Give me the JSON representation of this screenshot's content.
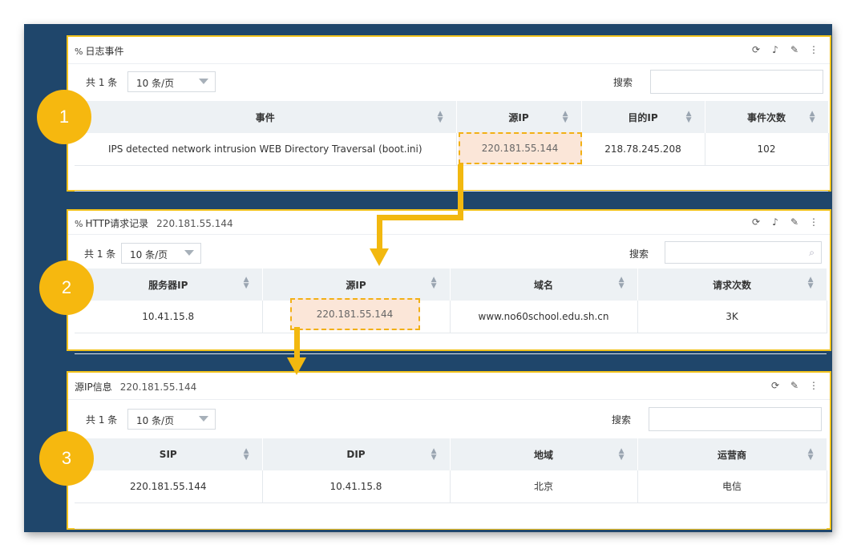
{
  "panel1": {
    "title": "日志事件",
    "total": "共 1 条",
    "page_size": "10 条/页",
    "search_label": "搜索",
    "columns": [
      "事件",
      "源IP",
      "目的IP",
      "事件次数"
    ],
    "row": [
      "IPS detected network intrusion WEB Directory Traversal (boot.ini)",
      "220.181.55.144",
      "218.78.245.208",
      "102"
    ]
  },
  "panel2": {
    "title": "HTTP请求记录",
    "subtitle": "220.181.55.144",
    "total": "共 1 条",
    "page_size": "10 条/页",
    "search_label": "搜索",
    "columns": [
      "服务器IP",
      "源IP",
      "域名",
      "请求次数"
    ],
    "row": [
      "10.41.15.8",
      "220.181.55.144",
      "www.no60school.edu.sh.cn",
      "3K"
    ]
  },
  "panel3": {
    "title": "源IP信息",
    "subtitle": "220.181.55.144",
    "total": "共 1 条",
    "page_size": "10 条/页",
    "search_label": "搜索",
    "columns": [
      "SIP",
      "DIP",
      "地域",
      "运营商"
    ],
    "row": [
      "220.181.55.144",
      "10.41.15.8",
      "北京",
      "电信"
    ]
  },
  "badges": [
    "1",
    "2",
    "3"
  ],
  "icons": {
    "link": "link-icon",
    "refresh": "refresh-icon",
    "bell": "bell-icon",
    "edit": "pencil-icon",
    "more": "more-vertical-icon",
    "search": "search-icon",
    "sort": "sort-icon",
    "caret": "caret-down-icon"
  },
  "colors": {
    "frame": "#1f466b",
    "highlight_border": "#f2c21b",
    "badge": "#f6b80f",
    "highlight_fill": "#fbe6d8"
  }
}
